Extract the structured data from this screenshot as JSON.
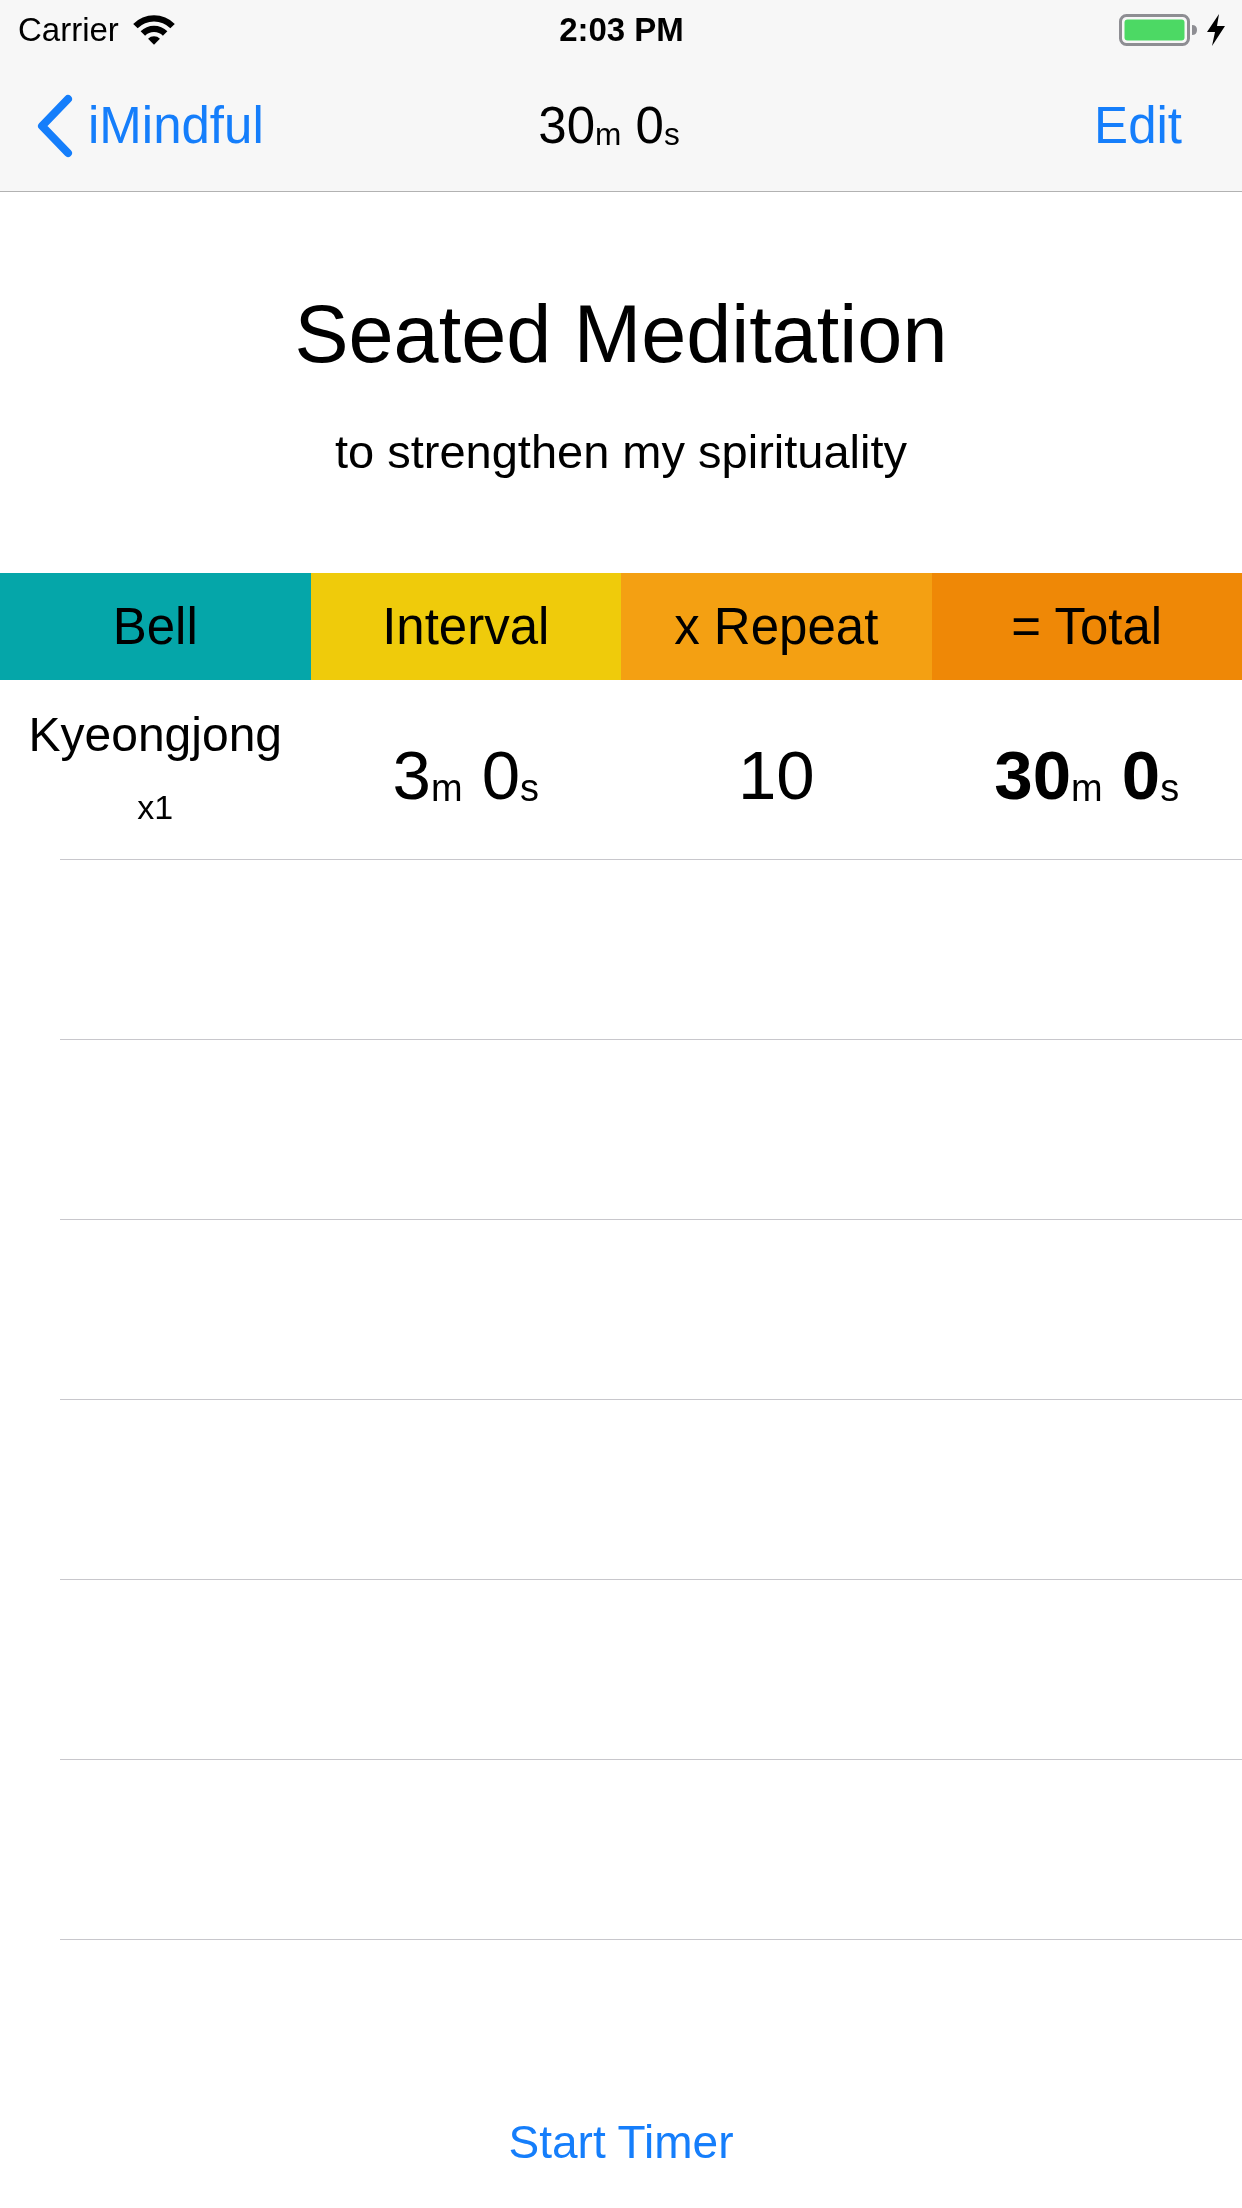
{
  "status_bar": {
    "carrier": "Carrier",
    "time": "2:03 PM"
  },
  "nav_bar": {
    "back_label": "iMindful",
    "title": "30$_{m}$ 0$_{s}$",
    "edit_label": "Edit"
  },
  "session": {
    "title": "Seated Meditation",
    "subtitle": "to strengthen my spirituality"
  },
  "table": {
    "columns": [
      {
        "label": "Bell",
        "color": "#05a6a9"
      },
      {
        "label": "Interval",
        "color": "#efcb0b"
      },
      {
        "label": "x Repeat",
        "color": "#f4a012"
      },
      {
        "label": "= Total",
        "color": "#ef8806"
      }
    ],
    "rows": [
      {
        "cells": [
          {
            "kind": "bell",
            "name": "Kyeongjong",
            "count": "x1"
          },
          {
            "kind": "interval",
            "text": "3$_{m}$ 0$_{s}$"
          },
          {
            "kind": "repeat",
            "text": "10"
          },
          {
            "kind": "total",
            "text": "30$_{m}$ 0$_{s}$"
          }
        ]
      }
    ]
  },
  "start_button": {
    "label": "Start Timer"
  }
}
